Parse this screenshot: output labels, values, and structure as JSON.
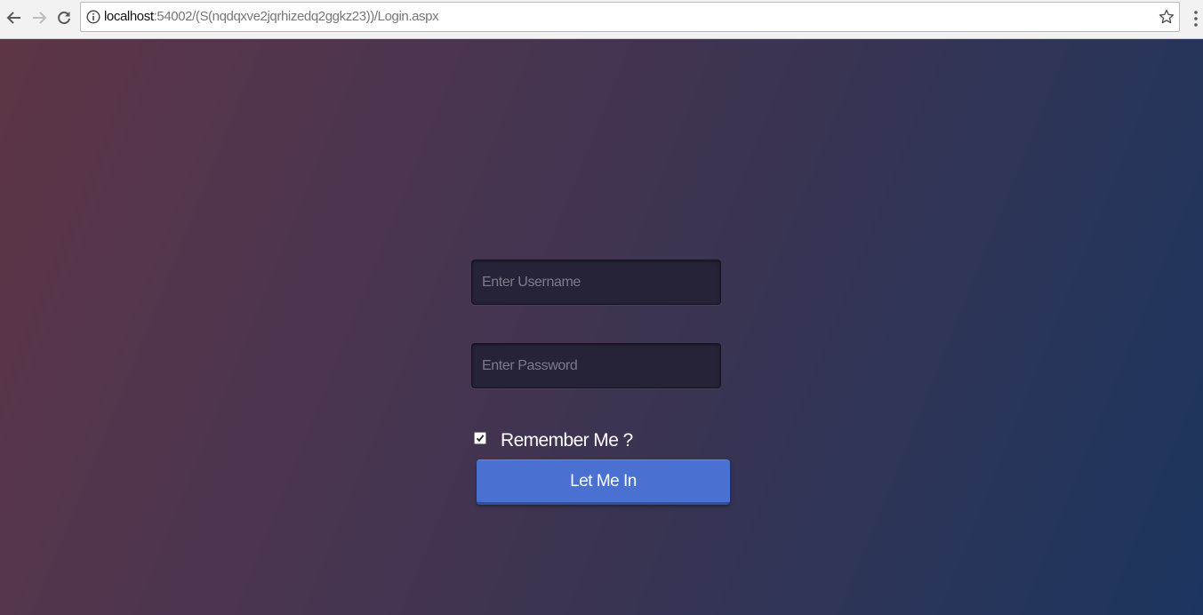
{
  "browser": {
    "url_host": "localhost",
    "url_path": ":54002/(S(nqdqxve2jqrhizedq2ggkz23))/Login.aspx",
    "icons": {
      "back": "back-arrow-icon",
      "forward": "forward-arrow-icon",
      "reload": "reload-icon",
      "info": "info-icon",
      "bookmark": "star-icon",
      "menu": "kebab-menu-icon"
    }
  },
  "login_form": {
    "username_placeholder": "Enter Username",
    "username_value": "",
    "password_placeholder": "Enter Password",
    "password_value": "",
    "remember_label": "Remember Me ?",
    "remember_checked": true,
    "submit_label": "Let Me In"
  },
  "colors": {
    "button": "#4a70d1",
    "input_background": "#262338",
    "gradient_left": "#5d3546",
    "gradient_right": "#1c3560"
  }
}
